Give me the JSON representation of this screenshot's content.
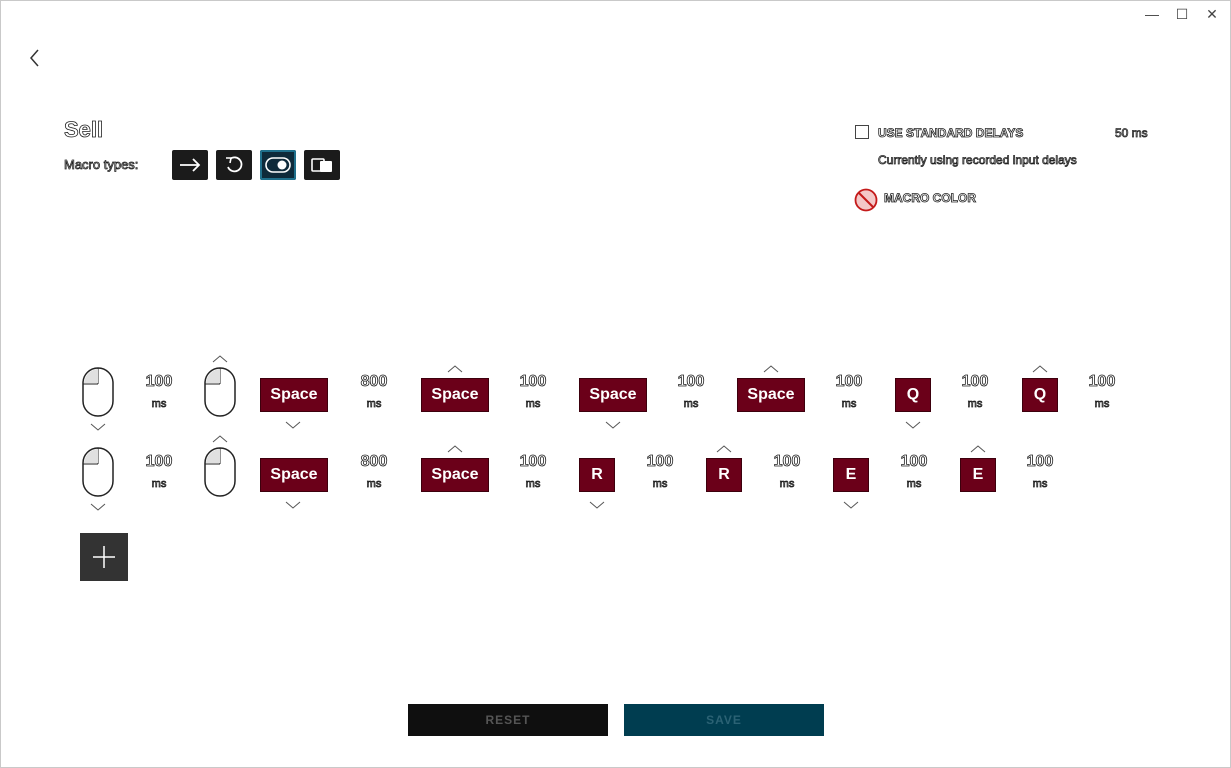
{
  "window": {
    "minimize_glyph": "—",
    "maximize_glyph": "☐",
    "close_glyph": "✕"
  },
  "macro": {
    "name": "Sell",
    "types_label": "Macro types:",
    "types": [
      "arrow-right-icon",
      "repeat-icon",
      "toggle-icon",
      "sequence-icon"
    ],
    "active_type_index": 2
  },
  "options": {
    "standard_delays_label": "USE STANDARD DELAYS",
    "standard_delays_checked": false,
    "standard_delay_value": "50 ms",
    "current_delay_note": "Currently using recorded input delays",
    "macro_color_label": "MACRO COLOR"
  },
  "steps": {
    "row1": {
      "d1": "100",
      "d2": "800",
      "d3": "100",
      "d4": "100",
      "d5": "100",
      "d6": "100",
      "d7": "100",
      "k1": "Space",
      "k2": "Space",
      "k3": "Space",
      "k4": "Space",
      "k5": "Q",
      "k6": "Q"
    },
    "row2": {
      "d1": "100",
      "d2": "800",
      "d3": "100",
      "d4": "100",
      "d5": "100",
      "d6": "100",
      "d7": "100",
      "k1": "Space",
      "k2": "Space",
      "k3": "R",
      "k4": "R",
      "k5": "E",
      "k6": "E"
    },
    "unit": "ms"
  },
  "actions": {
    "reset_label": "RESET",
    "save_label": "SAVE"
  },
  "colors": {
    "key_fill": "#6b0019",
    "save_fill": "#003d50",
    "reset_fill": "#0f0f0f"
  }
}
